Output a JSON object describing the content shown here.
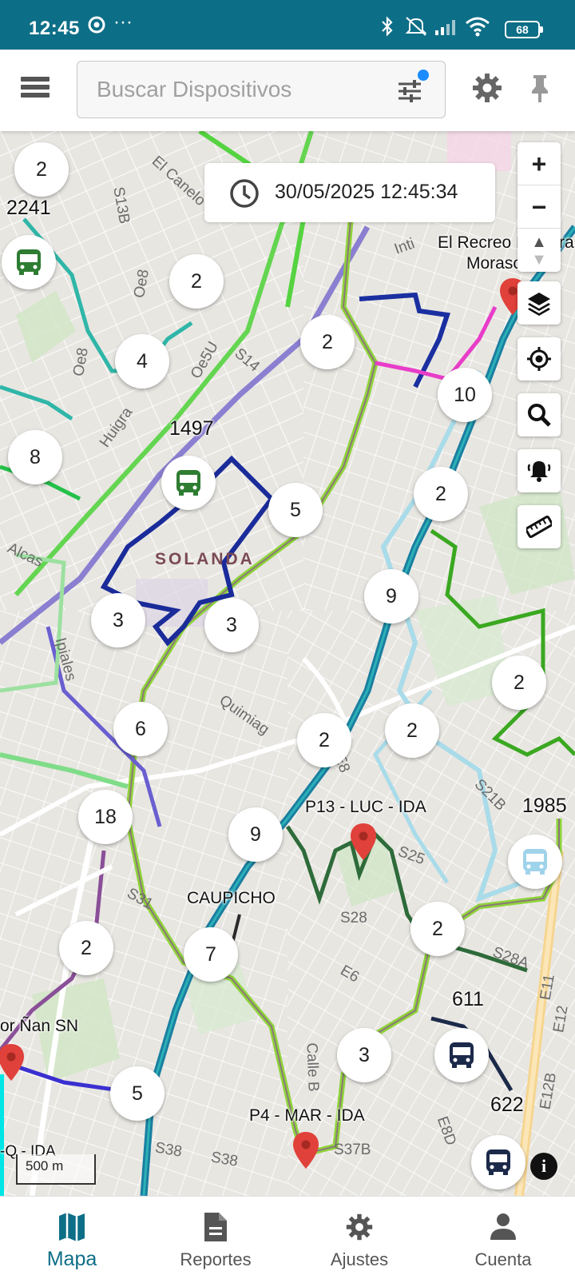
{
  "status_bar": {
    "time": "12:45",
    "battery": "68",
    "icons": [
      "chrome-icon",
      "more-icon",
      "bluetooth-icon",
      "mute-icon",
      "signal-icon",
      "wifi-icon",
      "battery-icon"
    ]
  },
  "header": {
    "search_placeholder": "Buscar Dispositivos",
    "icons": [
      "menu-icon",
      "filter-icon",
      "settings-gear-icon",
      "pin-icon"
    ],
    "accent_color": "#0d6e87"
  },
  "map": {
    "timestamp": "30/05/2025 12:45:34",
    "clusters": [
      "2",
      "2",
      "4",
      "2",
      "10",
      "8",
      "5",
      "2",
      "9",
      "3",
      "3",
      "2",
      "6",
      "2",
      "2",
      "18",
      "9",
      "7",
      "2",
      "2",
      "3",
      "5"
    ],
    "device_labels": [
      "2241",
      "1497",
      "1985",
      "611",
      "622"
    ],
    "route_labels": [
      "P13 - LUC - IDA",
      "P4 - MAR - IDA",
      "CAUPICHO",
      "or Ñan SN",
      "-Q - IDA"
    ],
    "place_labels": [
      "El Recreo N",
      "ra",
      "Morasc",
      "o"
    ],
    "district": "SOLANDA",
    "streets": [
      "El Canelo",
      "S13B",
      "Oe8",
      "Oe5U",
      "S14",
      "Huigra",
      "Inti",
      "Quimiag",
      "S21B",
      "S25",
      "S28",
      "E6",
      "S28A",
      "S31",
      "Calle B",
      "E8D",
      "E12B",
      "S38",
      "S38",
      "S37B",
      "E11",
      "E12",
      "Oe8",
      "Alcas",
      "Ipiales",
      "E8"
    ],
    "scale": "500 m",
    "controls": [
      "zoom-in",
      "zoom-out",
      "compass",
      "layers",
      "locate",
      "search",
      "alerts",
      "ruler"
    ]
  },
  "bottom_nav": {
    "items": [
      {
        "label": "Mapa",
        "active": true
      },
      {
        "label": "Reportes",
        "active": false
      },
      {
        "label": "Ajustes",
        "active": false
      },
      {
        "label": "Cuenta",
        "active": false
      }
    ]
  }
}
